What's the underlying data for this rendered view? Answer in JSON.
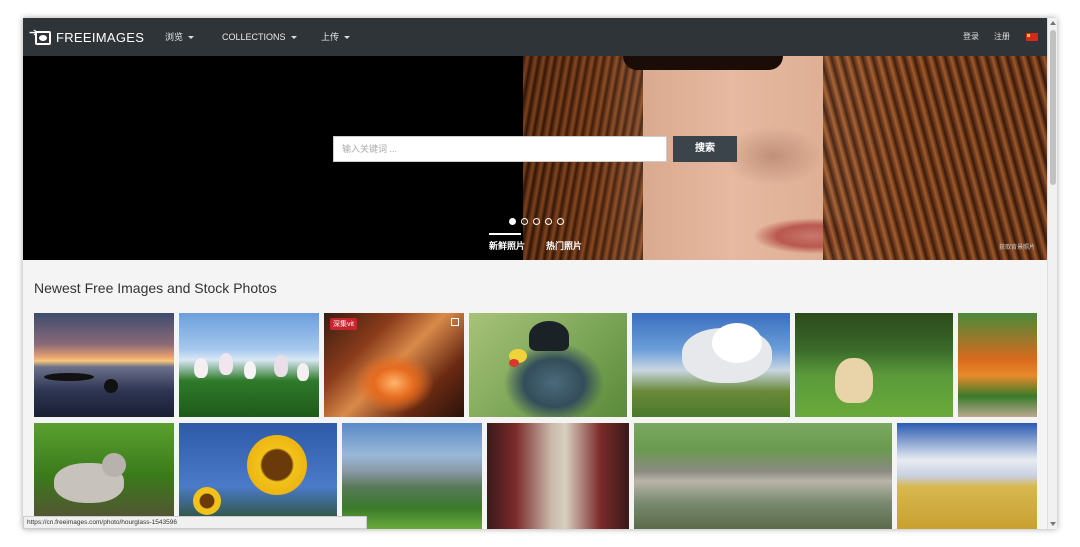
{
  "navbar": {
    "logo_text": "FREEIMAGES",
    "browse_label": "浏览",
    "collections_label": "COLLECTIONS",
    "upload_label": "上传",
    "login_label": "登录",
    "register_label": "注册",
    "language_flag": "china-flag-icon"
  },
  "hero": {
    "search_placeholder": "输入关键词 ...",
    "search_button": "搜索",
    "slide_count": 5,
    "active_slide": 1,
    "tab_new": "新鲜照片",
    "tab_popular": "热门照片",
    "credit": "获取背景照片"
  },
  "main": {
    "section_title": "Newest Free Images and Stock Photos",
    "premium_badge": "深集vit"
  },
  "status_url": "https://cn.freeimages.com/photo/hourglass-1543596",
  "colors": {
    "navbar": "#2f3438",
    "search_button": "#3b444b",
    "badge": "#c3262c"
  }
}
